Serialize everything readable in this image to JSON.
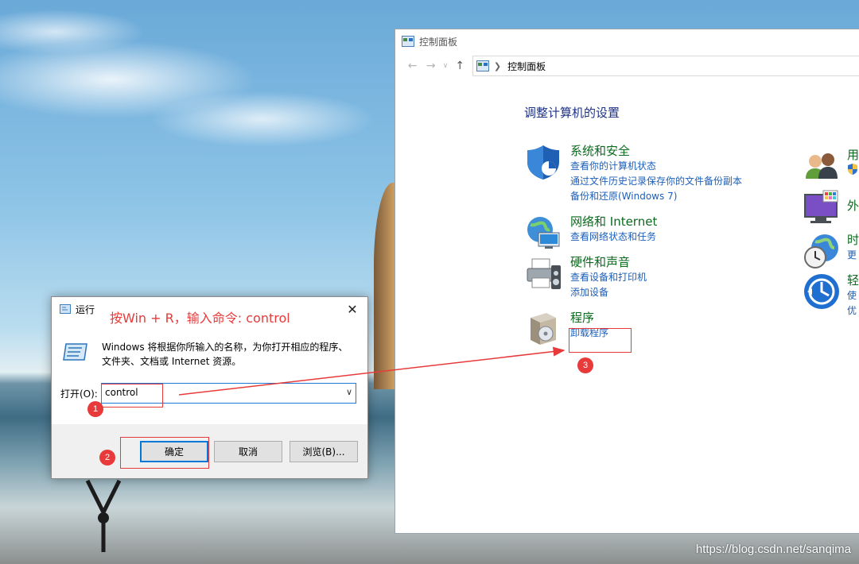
{
  "control_panel": {
    "window_title": "控制面板",
    "address_path": "控制面板",
    "heading": "调整计算机的设置",
    "categories": [
      {
        "title": "系统和安全",
        "links": [
          "查看你的计算机状态",
          "通过文件历史记录保存你的文件备份副本",
          "备份和还原(Windows 7)"
        ]
      },
      {
        "title": "网络和 Internet",
        "links": [
          "查看网络状态和任务"
        ]
      },
      {
        "title": "硬件和声音",
        "links": [
          "查看设备和打印机",
          "添加设备"
        ]
      },
      {
        "title": "程序",
        "links": [
          "卸载程序"
        ]
      }
    ],
    "right_categories": [
      {
        "title": "用",
        "link": ""
      },
      {
        "title": "外",
        "link": ""
      },
      {
        "title": "时",
        "link": "更"
      },
      {
        "title": "轻",
        "link": "使",
        "link2": "优"
      }
    ]
  },
  "run_dialog": {
    "title": "运行",
    "annotation": "按Win + R，输入命令: control",
    "description": "Windows 将根据你所输入的名称，为你打开相应的程序、文件夹、文档或 Internet 资源。",
    "open_label": "打开(O):",
    "input_value": "control",
    "ok_label": "确定",
    "cancel_label": "取消",
    "browse_label": "浏览(B)..."
  },
  "annotations": {
    "badge1": "1",
    "badge2": "2",
    "badge3": "3"
  },
  "watermark": "https://blog.csdn.net/sanqima"
}
